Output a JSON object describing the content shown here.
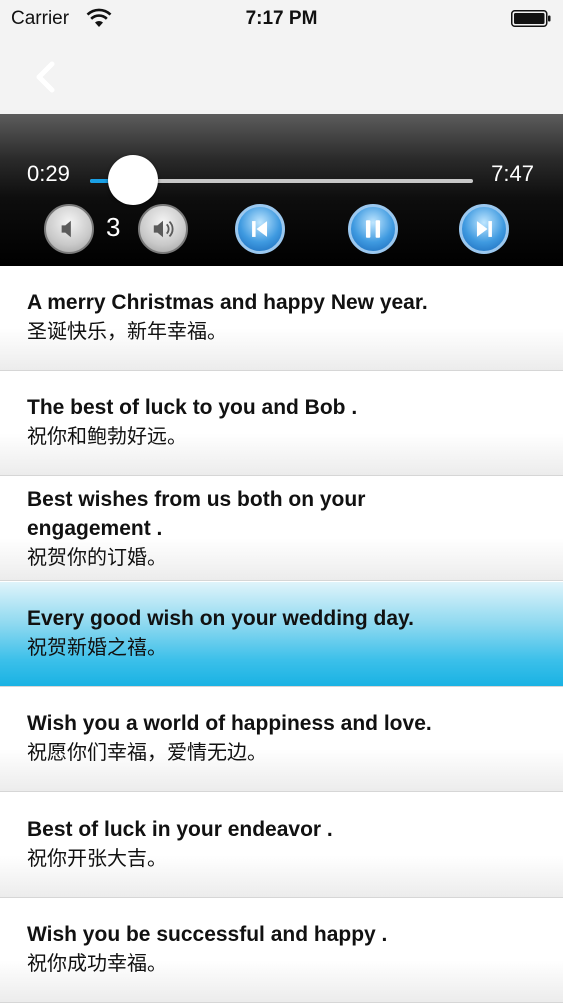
{
  "status_bar": {
    "carrier": "Carrier",
    "time": "7:17 PM"
  },
  "player": {
    "current_time": "0:29",
    "total_time": "7:47",
    "progress": 0.062,
    "volume_level": "3",
    "accent_color": "#1aa0e6",
    "buttons": [
      "volume-down-icon",
      "volume-up-icon",
      "previous-track-icon",
      "pause-icon",
      "next-track-icon"
    ]
  },
  "phrases": [
    {
      "en": "A merry Christmas and happy  New year.",
      "zh": "圣诞快乐，新年幸福。",
      "active": false
    },
    {
      "en": "The best of luck  to you and Bob .",
      "zh": "祝你和鲍勃好远。",
      "active": false
    },
    {
      "en": "Best wishes from us both on your engagement .",
      "zh": "祝贺你的订婚。",
      "active": false
    },
    {
      "en": "Every good wish on your wedding day.",
      "zh": "祝贺新婚之禧。",
      "active": true
    },
    {
      "en": "Wish you a world of happiness and love.",
      "zh": "祝愿你们幸福，爱情无边。",
      "active": false
    },
    {
      "en": "Best of luck in your endeavor .",
      "zh": "祝你开张大吉。",
      "active": false
    },
    {
      "en": "Wish you  be successful and happy .",
      "zh": "祝你成功幸福。",
      "active": false
    }
  ]
}
